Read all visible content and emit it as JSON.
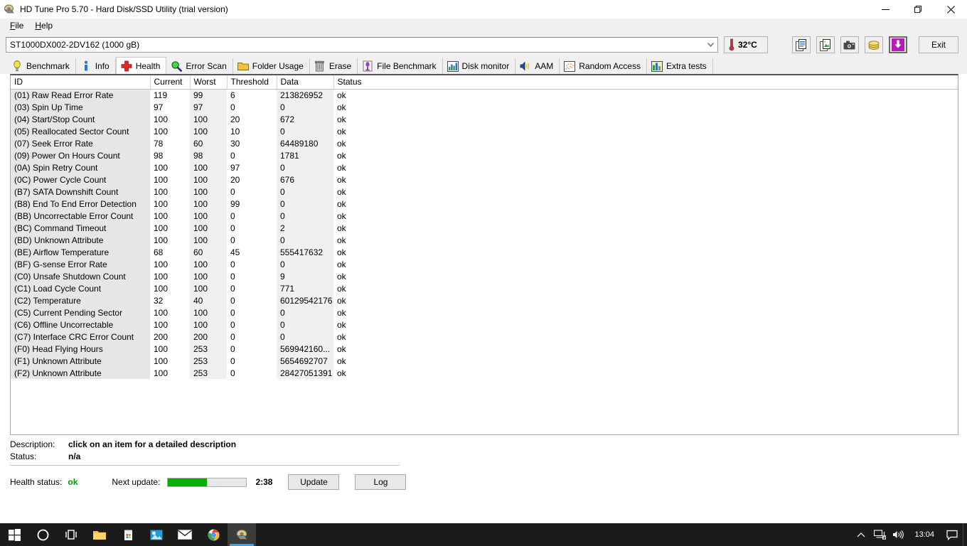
{
  "window": {
    "title": "HD Tune Pro 5.70 - Hard Disk/SSD Utility (trial version)",
    "icon": "harddisk-icon",
    "minimize_label": "Minimize",
    "restore_label": "Restore",
    "close_label": "Close"
  },
  "menu": {
    "items": [
      {
        "label": "File",
        "mnemonic": "F",
        "rest": "ile"
      },
      {
        "label": "Help",
        "mnemonic": "H",
        "rest": "elp"
      }
    ]
  },
  "drive_bar": {
    "selected_drive": "ST1000DX002-2DV162 (1000 gB)",
    "dropdown_icon": "chevron-down-icon",
    "temperature": "32°C",
    "temperature_icon": "thermometer-icon",
    "buttons": [
      {
        "name": "copy-text-button",
        "icon": "copy-text-icon",
        "tooltip": "Copy text"
      },
      {
        "name": "copy-image-button",
        "icon": "copy-image-icon",
        "tooltip": "Copy image"
      },
      {
        "name": "screenshot-button",
        "icon": "camera-icon",
        "tooltip": "Save screenshot"
      },
      {
        "name": "purchase-button",
        "icon": "coins-icon",
        "tooltip": "Buy"
      },
      {
        "name": "download-button",
        "icon": "download-arrow-icon",
        "tooltip": "Download"
      }
    ],
    "exit_label": "Exit"
  },
  "tabs": [
    {
      "label": "Benchmark",
      "icon": "lightbulb-icon",
      "active": false
    },
    {
      "label": "Info",
      "icon": "info-icon",
      "active": false
    },
    {
      "label": "Health",
      "icon": "red-cross-icon",
      "active": true
    },
    {
      "label": "Error Scan",
      "icon": "magnifier-icon",
      "active": false
    },
    {
      "label": "Folder Usage",
      "icon": "folder-icon",
      "active": false
    },
    {
      "label": "Erase",
      "icon": "trash-icon",
      "active": false
    },
    {
      "label": "File Benchmark",
      "icon": "file-benchmark-icon",
      "active": false
    },
    {
      "label": "Disk monitor",
      "icon": "bar-chart-icon",
      "active": false
    },
    {
      "label": "AAM",
      "icon": "speaker-icon",
      "active": false
    },
    {
      "label": "Random Access",
      "icon": "scatter-icon",
      "active": false
    },
    {
      "label": "Extra tests",
      "icon": "extra-tests-icon",
      "active": false
    }
  ],
  "table": {
    "columns": [
      "ID",
      "Current",
      "Worst",
      "Threshold",
      "Data",
      "Status"
    ],
    "rows": [
      [
        "(01) Raw Read Error Rate",
        "119",
        "99",
        "6",
        "213826952",
        "ok"
      ],
      [
        "(03) Spin Up Time",
        "97",
        "97",
        "0",
        "0",
        "ok"
      ],
      [
        "(04) Start/Stop Count",
        "100",
        "100",
        "20",
        "672",
        "ok"
      ],
      [
        "(05) Reallocated Sector Count",
        "100",
        "100",
        "10",
        "0",
        "ok"
      ],
      [
        "(07) Seek Error Rate",
        "78",
        "60",
        "30",
        "64489180",
        "ok"
      ],
      [
        "(09) Power On Hours Count",
        "98",
        "98",
        "0",
        "1781",
        "ok"
      ],
      [
        "(0A) Spin Retry Count",
        "100",
        "100",
        "97",
        "0",
        "ok"
      ],
      [
        "(0C) Power Cycle Count",
        "100",
        "100",
        "20",
        "676",
        "ok"
      ],
      [
        "(B7) SATA Downshift Count",
        "100",
        "100",
        "0",
        "0",
        "ok"
      ],
      [
        "(B8) End To End Error Detection",
        "100",
        "100",
        "99",
        "0",
        "ok"
      ],
      [
        "(BB) Uncorrectable Error Count",
        "100",
        "100",
        "0",
        "0",
        "ok"
      ],
      [
        "(BC) Command Timeout",
        "100",
        "100",
        "0",
        "2",
        "ok"
      ],
      [
        "(BD) Unknown Attribute",
        "100",
        "100",
        "0",
        "0",
        "ok"
      ],
      [
        "(BE) Airflow Temperature",
        "68",
        "60",
        "45",
        "555417632",
        "ok"
      ],
      [
        "(BF) G-sense Error Rate",
        "100",
        "100",
        "0",
        "0",
        "ok"
      ],
      [
        "(C0) Unsafe Shutdown Count",
        "100",
        "100",
        "0",
        "9",
        "ok"
      ],
      [
        "(C1) Load Cycle Count",
        "100",
        "100",
        "0",
        "771",
        "ok"
      ],
      [
        "(C2) Temperature",
        "32",
        "40",
        "0",
        "60129542176",
        "ok"
      ],
      [
        "(C5) Current Pending Sector",
        "100",
        "100",
        "0",
        "0",
        "ok"
      ],
      [
        "(C6) Offline Uncorrectable",
        "100",
        "100",
        "0",
        "0",
        "ok"
      ],
      [
        "(C7) Interface CRC Error Count",
        "200",
        "200",
        "0",
        "0",
        "ok"
      ],
      [
        "(F0) Head Flying Hours",
        "100",
        "253",
        "0",
        "569942160...",
        "ok"
      ],
      [
        "(F1) Unknown Attribute",
        "100",
        "253",
        "0",
        "5654692707",
        "ok"
      ],
      [
        "(F2) Unknown Attribute",
        "100",
        "253",
        "0",
        "28427051391",
        "ok"
      ]
    ]
  },
  "description_panel": {
    "description_label": "Description:",
    "description_value": "click on an item for a detailed description",
    "status_label": "Status:",
    "status_value": "n/a"
  },
  "footer": {
    "health_status_label": "Health status:",
    "health_status_value": "ok",
    "health_status_color": "#009900",
    "next_update_label": "Next update:",
    "progress_percent": 50,
    "progress_color": "#00b000",
    "timer": "2:38",
    "update_button": "Update",
    "log_button": "Log"
  },
  "taskbar": {
    "items": [
      {
        "name": "start-button",
        "icon": "windows-logo-icon",
        "active": false
      },
      {
        "name": "cortana-search",
        "icon": "circle-icon",
        "active": false
      },
      {
        "name": "task-view",
        "icon": "task-view-icon",
        "active": false
      },
      {
        "name": "file-explorer",
        "icon": "folder-icon",
        "active": false
      },
      {
        "name": "microsoft-store",
        "icon": "store-icon",
        "active": false
      },
      {
        "name": "photos-app",
        "icon": "photos-icon",
        "active": false
      },
      {
        "name": "mail-app",
        "icon": "mail-icon",
        "active": false
      },
      {
        "name": "google-chrome",
        "icon": "chrome-icon",
        "active": false
      },
      {
        "name": "hd-tune-pro",
        "icon": "harddisk-icon",
        "active": true
      }
    ],
    "tray": [
      {
        "name": "show-hidden-icons",
        "icon": "chevron-up-icon"
      },
      {
        "name": "network-icon",
        "icon": "network-icon"
      },
      {
        "name": "volume-icon",
        "icon": "speaker-icon"
      }
    ],
    "clock": "13:04",
    "action_center_icon": "notification-icon"
  }
}
